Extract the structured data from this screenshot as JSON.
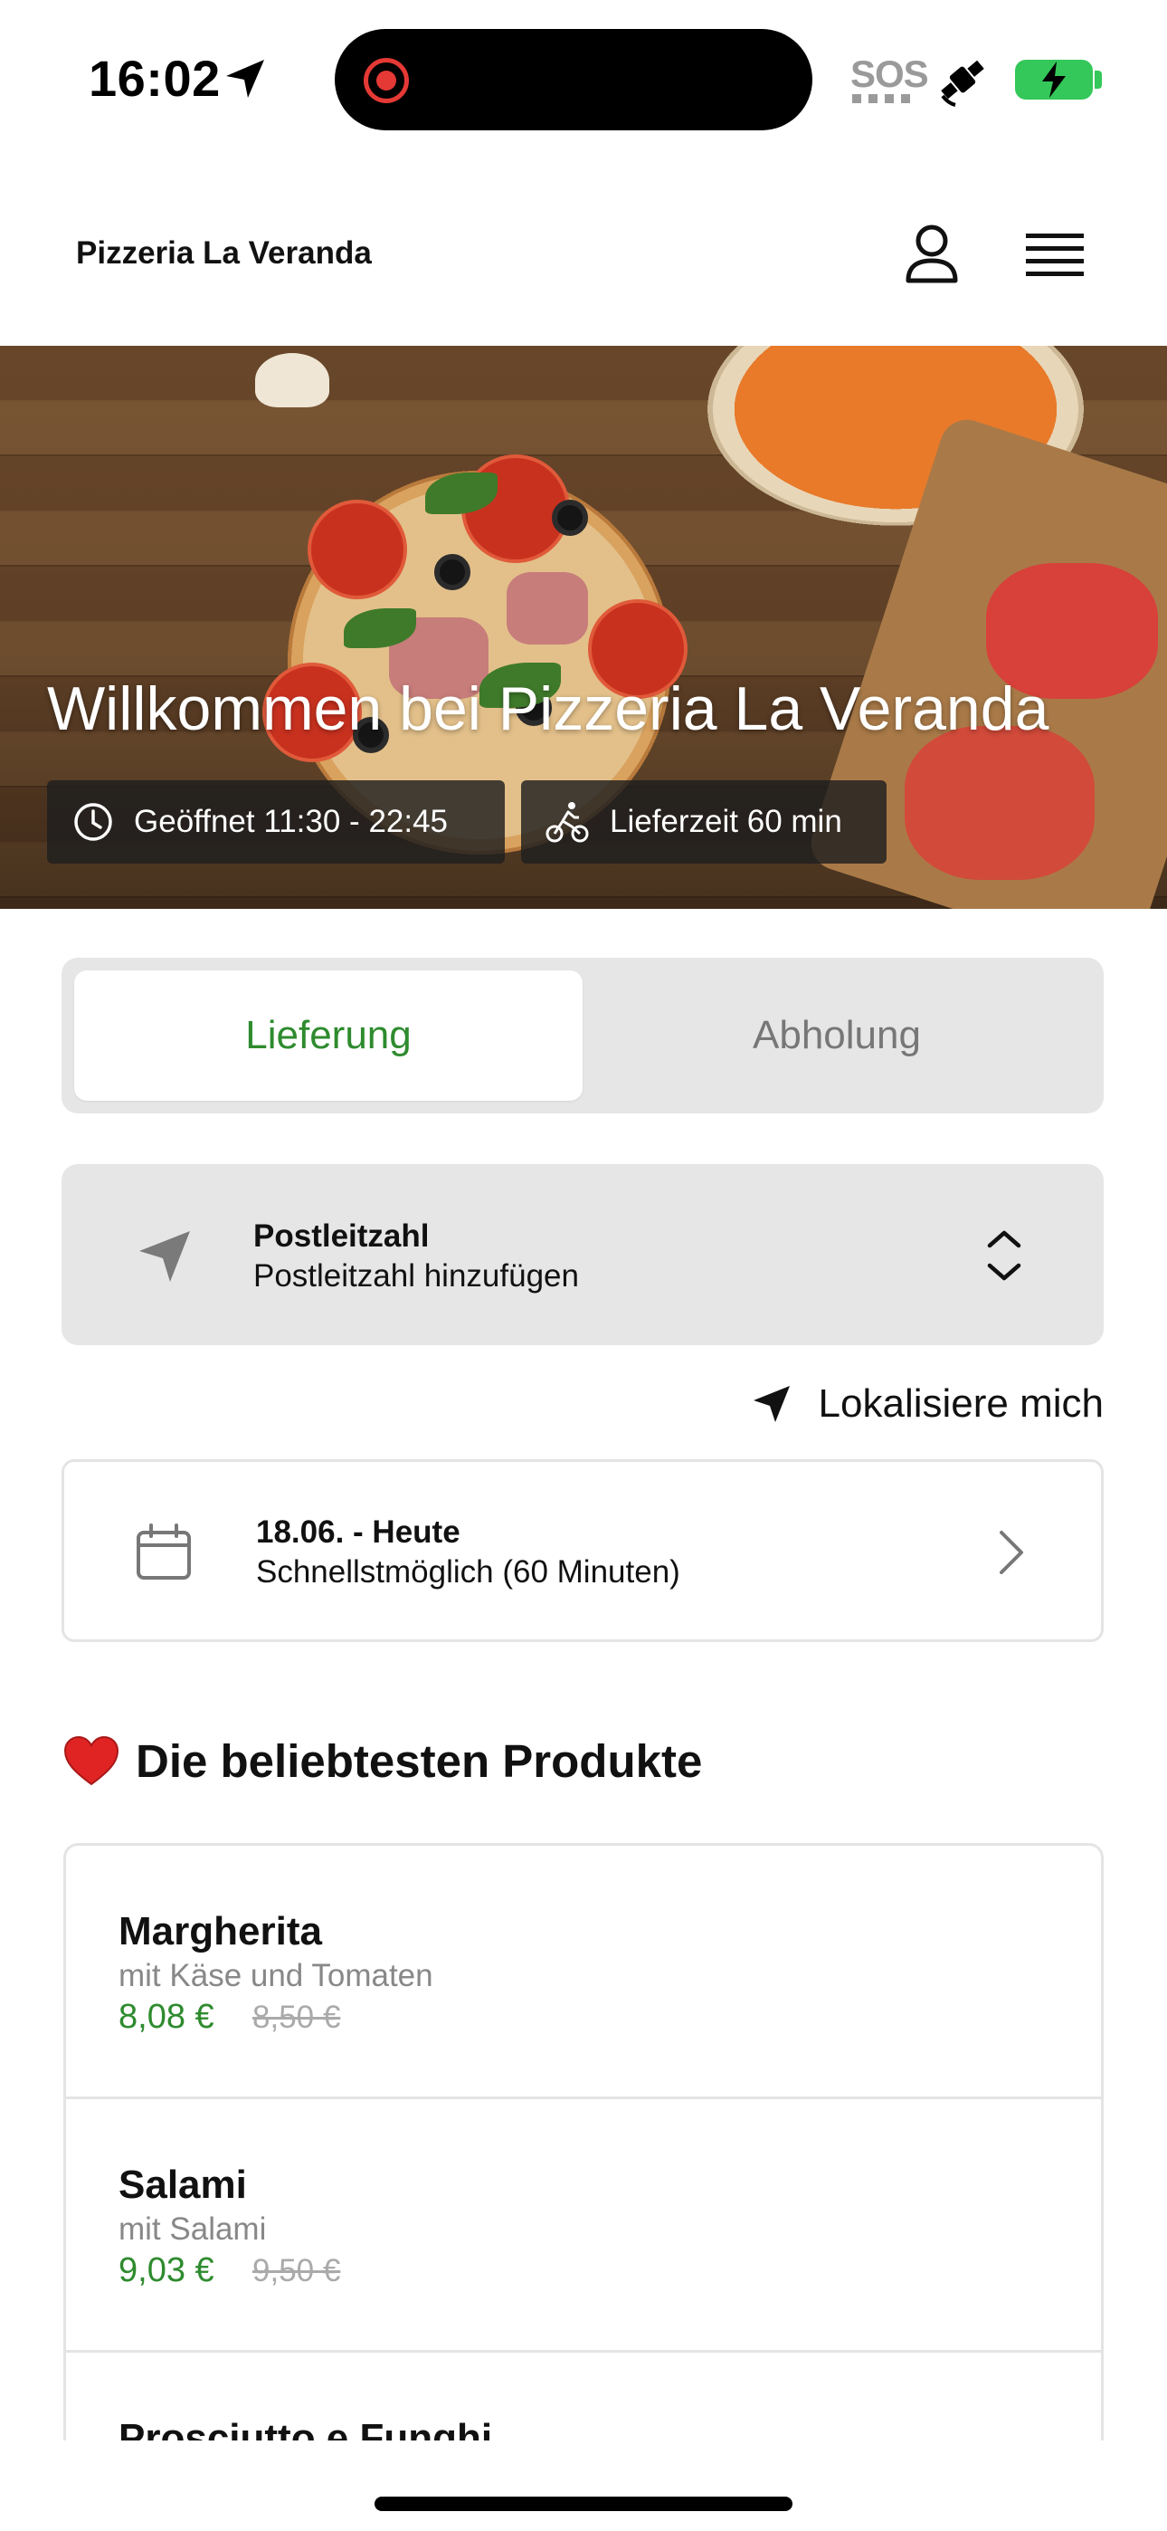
{
  "status_bar": {
    "time": "16:02",
    "sos": "SOS",
    "battery_color": "#34c759",
    "recording_color": "#e53935"
  },
  "header": {
    "brand": "Pizzeria La Veranda",
    "icons": [
      "user-icon",
      "menu-icon"
    ]
  },
  "hero": {
    "title": "Willkommen bei Pizzeria La Veranda",
    "opening_hours": "Geöffnet 11:30 - 22:45",
    "delivery_time": "Lieferzeit 60 min"
  },
  "order_mode": {
    "tabs": [
      {
        "label": "Lieferung",
        "active": true
      },
      {
        "label": "Abholung",
        "active": false
      }
    ],
    "active_color": "#2e8b2e"
  },
  "postal": {
    "label": "Postleitzahl",
    "placeholder": "Postleitzahl hinzufügen"
  },
  "locate_label": "Lokalisiere mich",
  "date": {
    "title": "18.06. - Heute",
    "subtitle": "Schnellstmöglich (60 Minuten)"
  },
  "popular": {
    "title": "Die beliebtesten Produkte",
    "products": [
      {
        "name": "Margherita",
        "description": "mit Käse und Tomaten",
        "price": "8,08 €",
        "old_price": "8,50 €"
      },
      {
        "name": "Salami",
        "description": "mit Salami",
        "price": "9,03 €",
        "old_price": "9,50 €"
      },
      {
        "name": "Prosciutto e Funghi",
        "description": "",
        "price": "",
        "old_price": ""
      }
    ]
  }
}
